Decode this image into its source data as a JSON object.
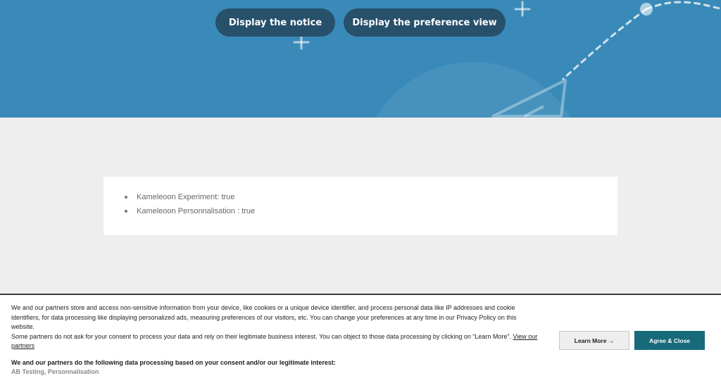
{
  "hero": {
    "notice_button": "Display the notice",
    "preference_button": "Display the preference view"
  },
  "status": {
    "items": [
      "Kameleoon Experiment: true",
      "Kameleoon Personnalisation : true"
    ]
  },
  "consent": {
    "paragraph1": "We and our partners store and access non-sensitive information from your device, like cookies or a unique device identifier, and process personal data like IP addresses and cookie identifiers, for data processing like displaying personalized ads, measuring preferences of our visitors, etc. You can change your preferences at any time in our Privacy Policy on this website.",
    "paragraph2": "Some partners do not ask for your consent to process your data and rely on their legitimate business interest. You can object to those data processing by clicking on “Learn More”.",
    "partners_link": "View our partners",
    "purposes_title": "We and our partners do the following data processing based on your consent and/or our legitimate interest:",
    "purposes": "AB Testing, Personnalisation",
    "learn_more_button": "Learn More →",
    "agree_button": "Agree & Close"
  },
  "colors": {
    "hero_bg": "#3a8ab9",
    "hero_button_bg": "#27506b",
    "agree_bg": "#176a79"
  }
}
